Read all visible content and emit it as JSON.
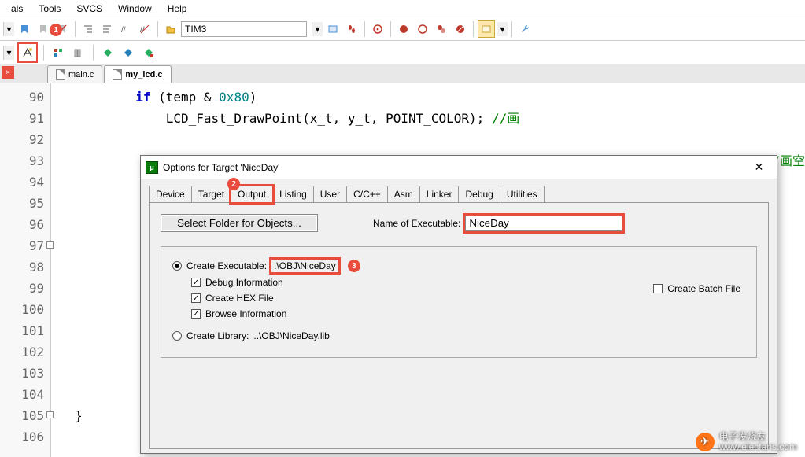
{
  "menu": {
    "items": [
      "als",
      "Tools",
      "SVCS",
      "Window",
      "Help"
    ]
  },
  "toolbar": {
    "target_dropdown": "TIM3"
  },
  "tabs": [
    {
      "label": "main.c",
      "active": false
    },
    {
      "label": "my_lcd.c",
      "active": true
    }
  ],
  "code_lines": {
    "start": 90,
    "end": 106,
    "body": [
      {
        "n": 90,
        "html": "        <span class='kw'>if</span> (temp & <span class='num'>0x80</span>)"
      },
      {
        "n": 91,
        "html": "            <span class='func'>LCD_Fast_DrawPoint</span>(x_t, y_t, POINT_COLOR); <span class='cmt'>//画</span>"
      },
      {
        "n": 92,
        "html": ""
      },
      {
        "n": 93,
        "html": "                                                                                            <span class='cmt'>/画空</span>"
      },
      {
        "n": 94,
        "html": ""
      },
      {
        "n": 95,
        "html": ""
      },
      {
        "n": 96,
        "html": ""
      },
      {
        "n": 97,
        "html": ""
      },
      {
        "n": 98,
        "html": ""
      },
      {
        "n": 99,
        "html": ""
      },
      {
        "n": 100,
        "html": ""
      },
      {
        "n": 101,
        "html": ""
      },
      {
        "n": 102,
        "html": ""
      },
      {
        "n": 103,
        "html": ""
      },
      {
        "n": 104,
        "html": ""
      },
      {
        "n": 105,
        "html": "}"
      },
      {
        "n": 106,
        "html": ""
      }
    ]
  },
  "dialog": {
    "title": "Options for Target 'NiceDay'",
    "tabs": [
      "Device",
      "Target",
      "Output",
      "Listing",
      "User",
      "C/C++",
      "Asm",
      "Linker",
      "Debug",
      "Utilities"
    ],
    "active_tab": "Output",
    "select_folder": "Select Folder for Objects...",
    "name_exec_label": "Name of Executable:",
    "name_exec_value": "NiceDay",
    "create_exec_label": "Create Executable:",
    "create_exec_path": ".\\OBJ\\NiceDay",
    "debug_info": "Debug Information",
    "hex_file": "Create HEX File",
    "browse_info": "Browse Information",
    "batch_file": "Create Batch File",
    "create_lib_label": "Create Library:",
    "create_lib_path": "..\\OBJ\\NiceDay.lib"
  },
  "callouts": {
    "1": "1",
    "2": "2",
    "3": "3"
  },
  "watermark": {
    "brand": "电子发烧友",
    "url": "www.elecfans.com"
  }
}
